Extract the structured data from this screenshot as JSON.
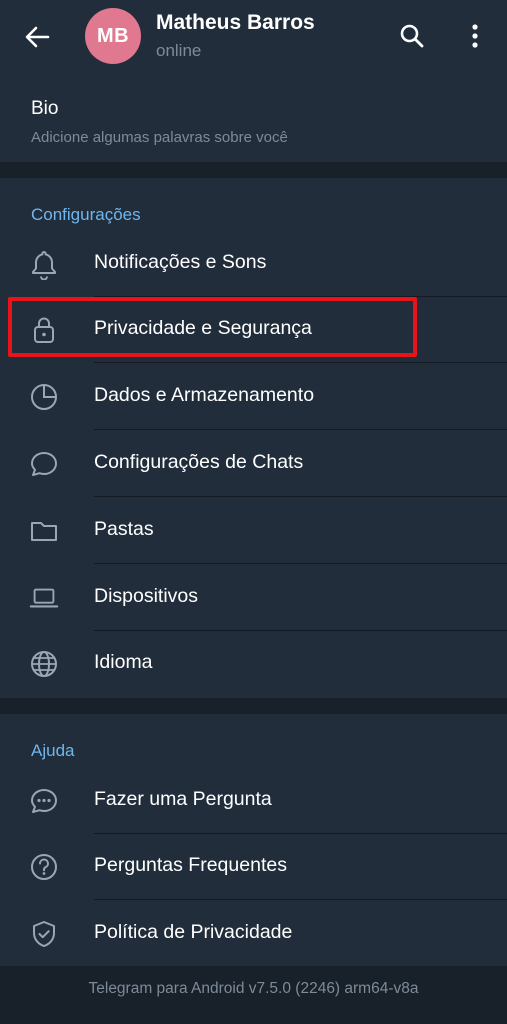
{
  "header": {
    "avatar_initials": "MB",
    "avatar_color": "#e0788f",
    "name": "Matheus Barros",
    "status": "online",
    "back_icon": "arrow-left-icon",
    "search_icon": "search-icon",
    "more_icon": "more-vertical-icon"
  },
  "bio": {
    "title": "Bio",
    "subtitle": "Adicione algumas palavras sobre você"
  },
  "settings": {
    "title": "Configurações",
    "items": [
      {
        "label": "Notificações e Sons",
        "icon": "bell-icon"
      },
      {
        "label": "Privacidade e Segurança",
        "icon": "lock-icon"
      },
      {
        "label": "Dados e Armazenamento",
        "icon": "pie-chart-icon"
      },
      {
        "label": "Configurações de Chats",
        "icon": "chat-bubble-icon"
      },
      {
        "label": "Pastas",
        "icon": "folder-icon"
      },
      {
        "label": "Dispositivos",
        "icon": "laptop-icon"
      },
      {
        "label": "Idioma",
        "icon": "globe-icon"
      }
    ]
  },
  "help": {
    "title": "Ajuda",
    "items": [
      {
        "label": "Fazer uma Pergunta",
        "icon": "chat-dots-icon"
      },
      {
        "label": "Perguntas Frequentes",
        "icon": "question-circle-icon"
      },
      {
        "label": "Política de Privacidade",
        "icon": "shield-check-icon"
      }
    ]
  },
  "footer": {
    "version": "Telegram para Android v7.5.0 (2246) arm64-v8a"
  },
  "colors": {
    "background": "#182029",
    "surface": "#212d3b",
    "accent": "#6fb6ee",
    "highlight": "#e8141a"
  }
}
